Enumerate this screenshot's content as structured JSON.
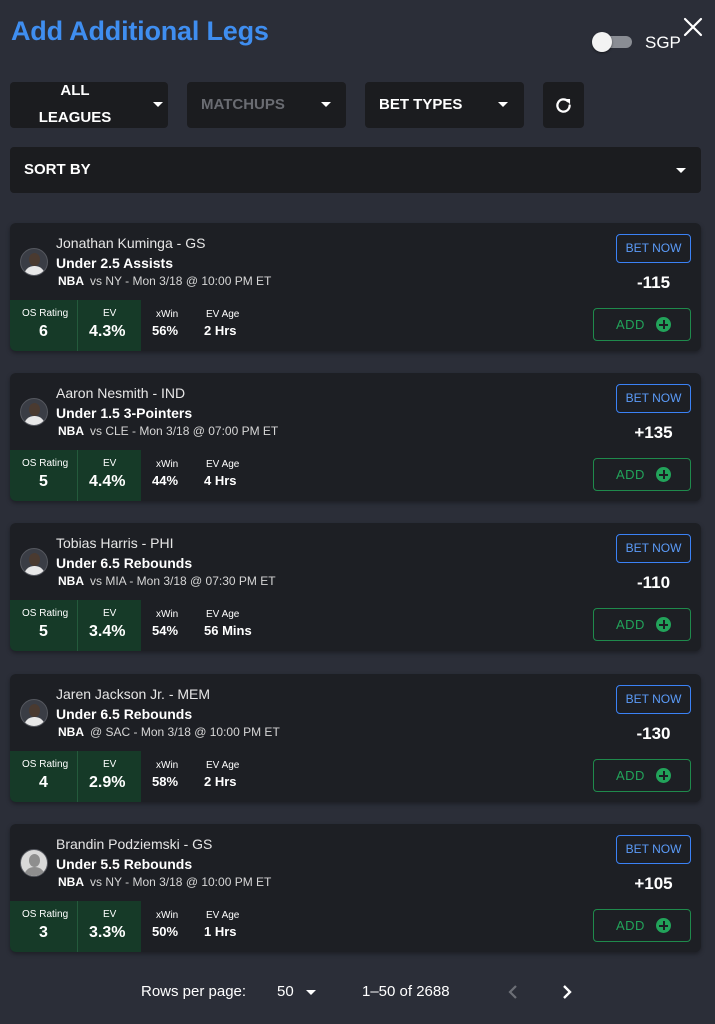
{
  "header": {
    "title": "Add Additional Legs",
    "sgp_label": "SGP",
    "sgp_enabled": false
  },
  "filters": {
    "leagues_line1": "ALL",
    "leagues_line2": "LEAGUES",
    "matchups": "MATCHUPS",
    "bet_types": "BET TYPES",
    "sort_by": "SORT BY"
  },
  "stat_labels": {
    "os_rating": "OS Rating",
    "ev": "EV",
    "xwin": "xWin",
    "ev_age": "EV Age"
  },
  "buttons": {
    "bet_now": "BET NOW",
    "add": "ADD"
  },
  "cards": [
    {
      "player": "Jonathan Kuminga - GS",
      "market": "Under 2.5 Assists",
      "league": "NBA",
      "game": "vs NY - Mon 3/18 @ 10:00 PM ET",
      "odds": "-115",
      "os_rating": "6",
      "ev": "4.3%",
      "xwin": "56%",
      "ev_age": "2 Hrs"
    },
    {
      "player": "Aaron Nesmith - IND",
      "market": "Under 1.5 3-Pointers",
      "league": "NBA",
      "game": "vs CLE - Mon 3/18 @ 07:00 PM ET",
      "odds": "+135",
      "os_rating": "5",
      "ev": "4.4%",
      "xwin": "44%",
      "ev_age": "4 Hrs"
    },
    {
      "player": "Tobias Harris - PHI",
      "market": "Under 6.5 Rebounds",
      "league": "NBA",
      "game": "vs MIA - Mon 3/18 @ 07:30 PM ET",
      "odds": "-110",
      "os_rating": "5",
      "ev": "3.4%",
      "xwin": "54%",
      "ev_age": "56 Mins"
    },
    {
      "player": "Jaren Jackson Jr. - MEM",
      "market": "Under 6.5 Rebounds",
      "league": "NBA",
      "game": "@ SAC - Mon 3/18 @ 10:00 PM ET",
      "odds": "-130",
      "os_rating": "4",
      "ev": "2.9%",
      "xwin": "58%",
      "ev_age": "2 Hrs"
    },
    {
      "player": "Brandin Podziemski - GS",
      "market": "Under 5.5 Rebounds",
      "league": "NBA",
      "game": "vs NY - Mon 3/18 @ 10:00 PM ET",
      "odds": "+105",
      "os_rating": "3",
      "ev": "3.3%",
      "xwin": "50%",
      "ev_age": "1 Hrs"
    }
  ],
  "pagination": {
    "rows_per_page_label": "Rows per page:",
    "rows_per_page_value": "50",
    "range": "1–50 of 2688"
  },
  "colors": {
    "title_blue": "#3f8ef0",
    "stat_green": "#163a28",
    "add_green": "#22a35a",
    "bet_now_blue": "#3b82f6"
  }
}
